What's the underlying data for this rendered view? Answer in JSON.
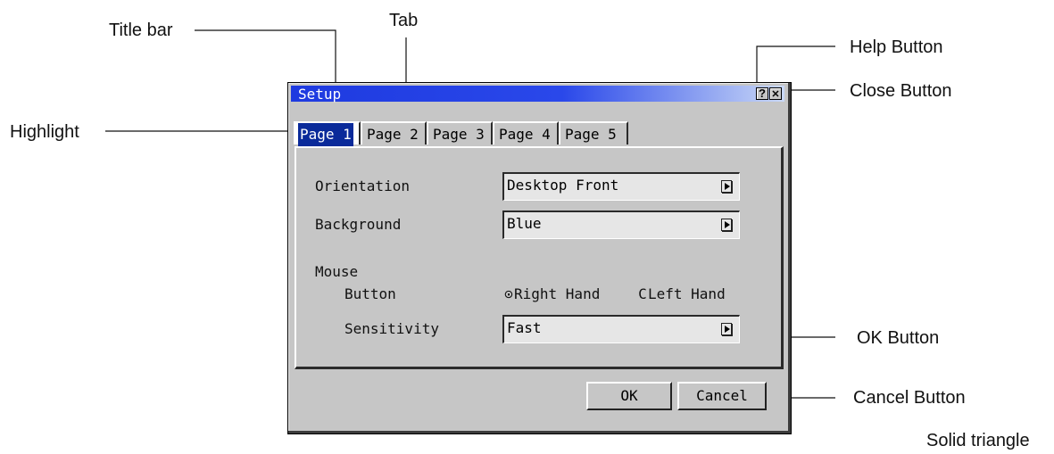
{
  "callouts": {
    "title_bar": "Title bar",
    "tab": "Tab",
    "help_button": "Help Button",
    "close_button": "Close Button",
    "highlight": "Highlight",
    "ok_button": "OK Button",
    "cancel_button": "Cancel Button",
    "solid_triangle": "Solid triangle"
  },
  "dialog": {
    "title": "Setup",
    "help_glyph": "?",
    "close_glyph": "✕",
    "tabs": [
      "Page 1",
      "Page 2",
      "Page 3",
      "Page 4",
      "Page 5"
    ],
    "active_tab": "Page 1",
    "orientation": {
      "label": "Orientation",
      "value": "Desktop Front"
    },
    "background": {
      "label": "Background",
      "value": "Blue"
    },
    "mouse": {
      "heading": "Mouse",
      "button_label": "Button",
      "options": [
        "Right Hand",
        "Left Hand"
      ],
      "selected": "Right Hand",
      "selected_glyph": "⊙",
      "unselected_glyph": "C",
      "sensitivity_label": "Sensitivity",
      "sensitivity_value": "Fast"
    },
    "ok_label": "OK",
    "cancel_label": "Cancel"
  },
  "colors": {
    "titlebar_start": "#1e3ae0",
    "titlebar_end": "#c9d8f6",
    "dialog_face": "#c6c6c6",
    "highlight": "#0a2a9a"
  }
}
